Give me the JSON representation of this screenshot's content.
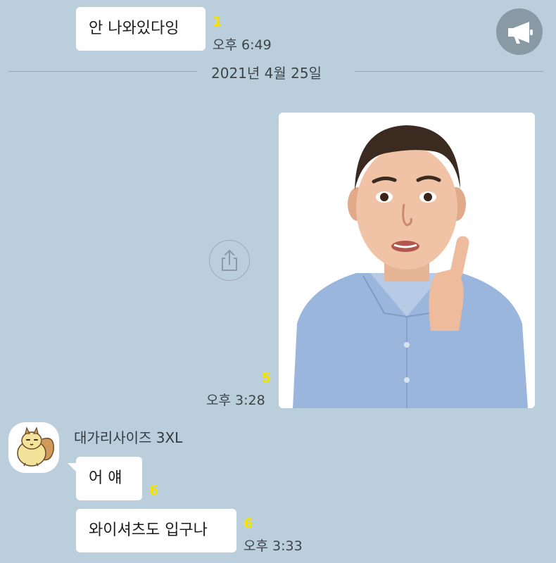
{
  "messages": {
    "m1": {
      "text": "안 나와있다잉",
      "unread": "1",
      "time": "오후 6:49"
    },
    "image_msg": {
      "unread": "5",
      "time": "오후 3:28"
    },
    "m2": {
      "text": "어 얘",
      "unread": "6"
    },
    "m3": {
      "text": "와이셔츠도 입구나",
      "unread": "6",
      "time": "오후 3:33"
    }
  },
  "date_divider": "2021년 4월 25일",
  "sender": {
    "name": "대가리사이즈 3XL"
  },
  "icons": {
    "announce": "megaphone-icon",
    "share": "share-icon",
    "avatar": "squirrel-avatar-icon"
  },
  "colors": {
    "background": "#bacedb",
    "bubble": "#ffffff",
    "unread": "#f5e400",
    "text": "#1c1c1c"
  }
}
